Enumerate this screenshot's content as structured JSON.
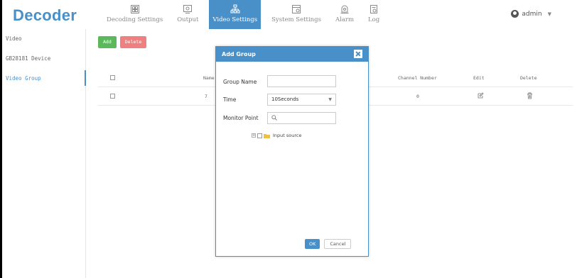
{
  "app": {
    "logo": "Decoder"
  },
  "nav": {
    "items": [
      {
        "label": "Decoding Settings",
        "icon": "grid-icon",
        "active": false
      },
      {
        "label": "Output",
        "icon": "monitor-icon",
        "active": false
      },
      {
        "label": "Video Settings",
        "icon": "network-icon",
        "active": true
      },
      {
        "label": "System Settings",
        "icon": "settings-panel-icon",
        "active": false
      },
      {
        "label": "Alarm",
        "icon": "alarm-icon",
        "active": false
      },
      {
        "label": "Log",
        "icon": "log-icon",
        "active": false
      }
    ]
  },
  "user": {
    "name": "admin"
  },
  "sidebar": {
    "items": [
      {
        "label": "Video"
      },
      {
        "label": "GB28181 Device"
      },
      {
        "label": "Video Group"
      }
    ]
  },
  "toolbar": {
    "add_label": "Add",
    "delete_label": "Delete"
  },
  "table": {
    "headers": {
      "name": "Name",
      "channel_number": "Channel Number",
      "edit": "Edit",
      "delete": "Delete"
    },
    "rows": [
      {
        "name": "7",
        "channel_number": "0"
      }
    ]
  },
  "modal": {
    "title": "Add Group",
    "group_name_label": "Group Name",
    "group_name_value": "",
    "time_label": "Time",
    "time_value": "10Seconds",
    "monitor_point_label": "Monitor Point",
    "monitor_search_value": "",
    "tree_root_label": "Input source",
    "ok_label": "OK",
    "cancel_label": "Cancel"
  },
  "colors": {
    "accent": "#4a90c8",
    "add": "#5cb85c",
    "delete": "#f08080"
  }
}
